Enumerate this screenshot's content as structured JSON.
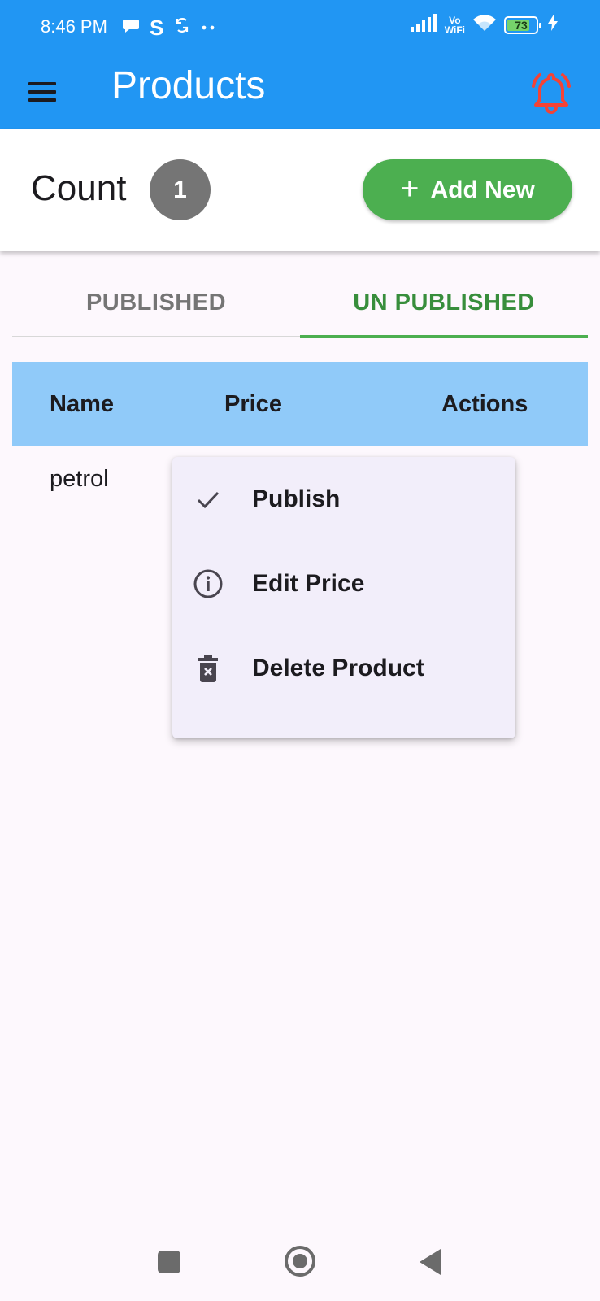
{
  "status_bar": {
    "time": "8:46 PM",
    "vo": "Vo",
    "wifi_label": "WiFi",
    "battery": "73",
    "icons": [
      "chat-bubble-icon",
      "s-app-icon",
      "sync-icon",
      "more-dots-icon",
      "signal-icon",
      "wifi-icon",
      "battery-icon",
      "charging-icon"
    ]
  },
  "app_bar": {
    "title": "Products",
    "menu_icon": "hamburger-menu-icon",
    "alert_icon": "ringing-bell-icon"
  },
  "summary": {
    "count_label": "Count",
    "count_value": "1",
    "add_button_label": "Add New",
    "add_icon": "plus-icon"
  },
  "tabs": [
    {
      "label": "PUBLISHED",
      "selected": false
    },
    {
      "label": "UN PUBLISHED",
      "selected": true
    }
  ],
  "table": {
    "columns": [
      "Name",
      "Price",
      "Actions"
    ],
    "rows": [
      {
        "name": "petrol"
      }
    ]
  },
  "context_menu": {
    "items": [
      {
        "label": "Publish",
        "icon": "check-icon"
      },
      {
        "label": "Edit Price",
        "icon": "info-icon"
      },
      {
        "label": "Delete Product",
        "icon": "trash-icon"
      }
    ]
  },
  "colors": {
    "primary": "#2196f3",
    "accent_green": "#4caf50",
    "tab_active": "#388e3c",
    "header_row": "#90caf9",
    "bell": "#f44336",
    "badge": "#757575"
  }
}
